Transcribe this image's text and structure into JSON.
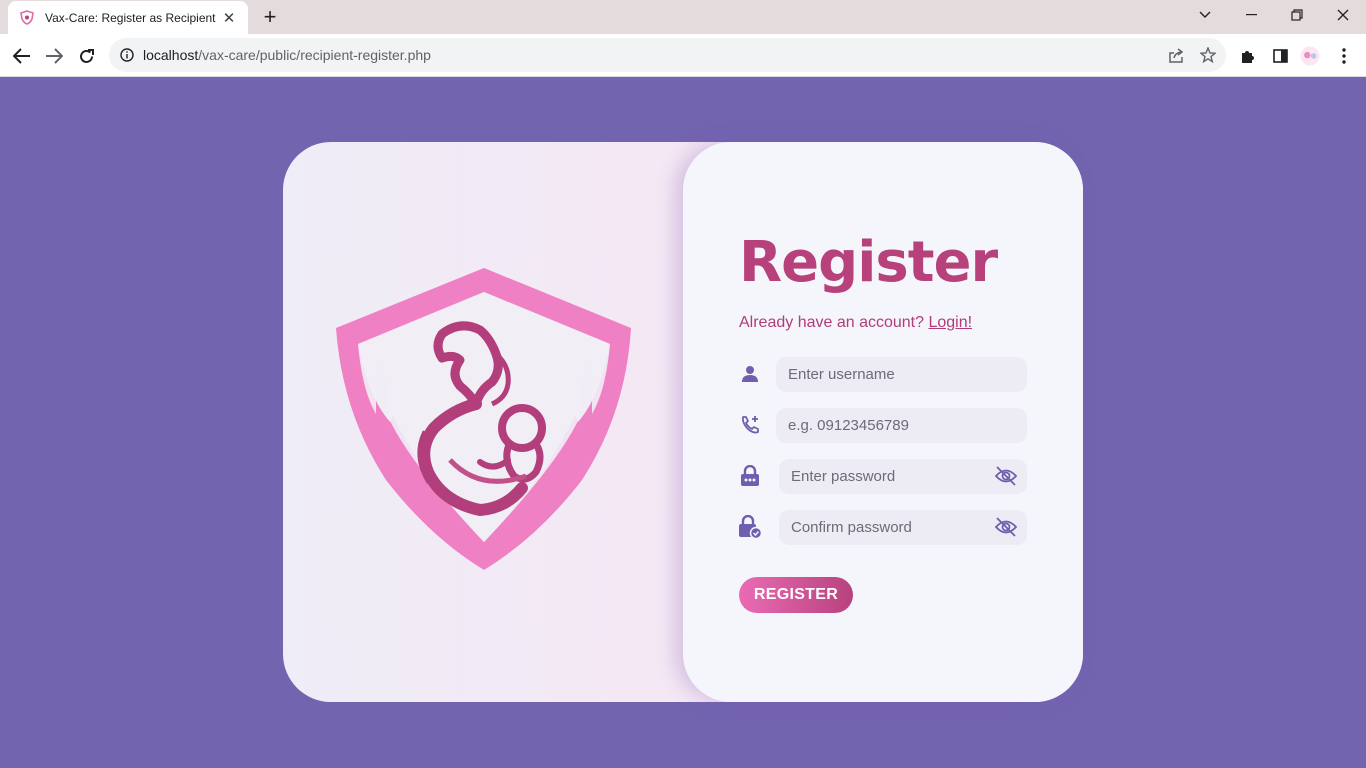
{
  "browser": {
    "tab_title": "Vax-Care: Register as Recipient",
    "url_host": "localhost",
    "url_path": "/vax-care/public/recipient-register.php"
  },
  "page": {
    "title": "Register",
    "subtitle": "Already have an account?",
    "login_link": "Login!",
    "username_placeholder": "Enter username",
    "phone_placeholder": "e.g. 09123456789",
    "password_placeholder": "Enter password",
    "confirm_placeholder": "Confirm password",
    "register_label": "REGISTER"
  },
  "colors": {
    "background": "#7364b0",
    "accent": "#b7417b",
    "icon": "#6f5fae",
    "logo_pink": "#ee7fc2"
  },
  "icons": {
    "username": "person-icon",
    "phone": "phone-plus-icon",
    "password": "lock-icon",
    "confirm": "lock-check-icon",
    "toggle": "eye-slash-icon"
  }
}
